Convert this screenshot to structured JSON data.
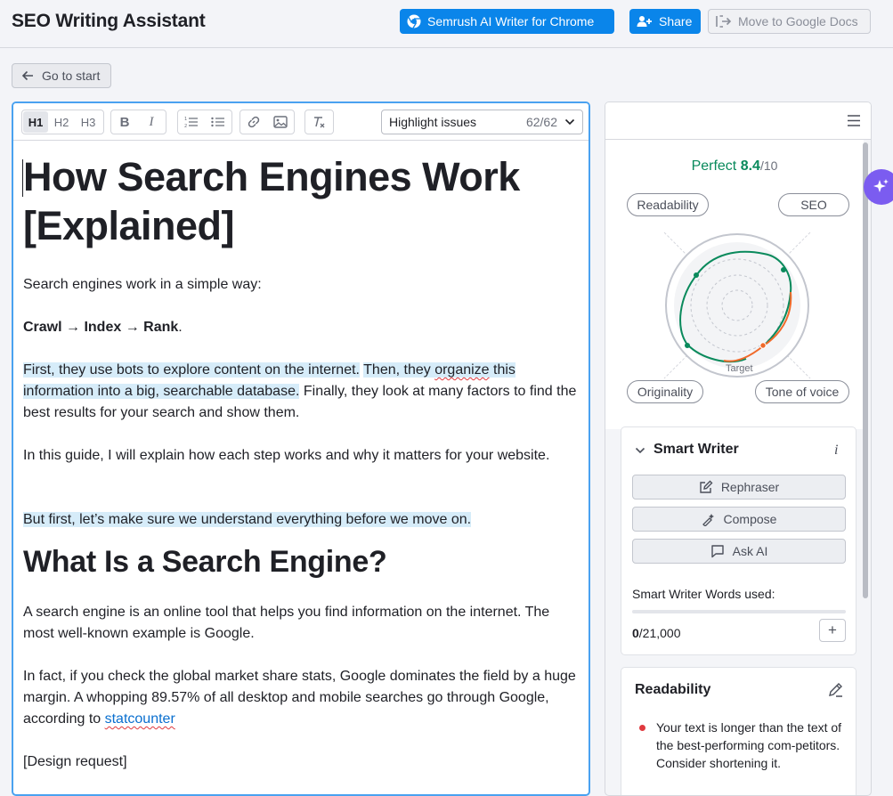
{
  "header": {
    "title": "SEO Writing Assistant",
    "chrome_button": "Semrush AI Writer for Chrome",
    "share_button": "Share",
    "google_docs_button": "Move to Google Docs"
  },
  "nav": {
    "go_to_start": "Go to start"
  },
  "toolbar": {
    "h1": "H1",
    "h2": "H2",
    "h3": "H3",
    "bold": "B",
    "italic": "I",
    "highlight_select": "Highlight issues",
    "highlight_count": "62/62"
  },
  "document": {
    "title": "How Search Engines Work [Explained]",
    "p1": "Search engines work in a simple way:",
    "p2": "Crawl → Index → Rank",
    "p2_end": ".",
    "p3_hl1": "First, they use bots to explore content on the internet.",
    "p3_hl2a": "Then, they ",
    "p3_hl2_word": "organize",
    "p3_hl2b": " this information into a big, searchable database.",
    "p3_rest": " Finally, they look at many factors to find the best results for your search and show them.",
    "p4": "In this guide, I will explain how each step works and why it matters for your website.",
    "p5": "But first, let’s make sure we understand everything before we move on.",
    "h2": "What Is a Search Engine?",
    "p6": "A search engine is an online tool that helps you find information on the internet. The most well-known example is Google.",
    "p7": "In fact, if you check the global market share stats, Google dominates the field by a huge margin. A whopping 89.57% of all desktop and mobile searches go through Google, according to ",
    "p7_link": "statcounter",
    "p8": "[Design request]"
  },
  "score": {
    "label": "Perfect",
    "value": "8.4",
    "max": "/10",
    "readability": "Readability",
    "seo": "SEO",
    "originality": "Originality",
    "tone": "Tone of voice",
    "target": "Target"
  },
  "smart_writer": {
    "title": "Smart Writer",
    "info": "i",
    "rephraser": "Rephraser",
    "compose": "Compose",
    "ask_ai": "Ask AI",
    "words_label": "Smart Writer Words used:",
    "words_used": "0",
    "words_total": "/21,000",
    "words_used_fraction": 0
  },
  "readability_card": {
    "title": "Readability",
    "issue": "Your text is longer than the text of the best-performing com-petitors. Consider shortening it."
  },
  "colors": {
    "primary": "#0a85ea",
    "good": "#0a8a5c",
    "warning": "#f06a2a",
    "error": "#e0393e",
    "highlight": "#d6ecf9",
    "ai": "#7b5cf0"
  }
}
